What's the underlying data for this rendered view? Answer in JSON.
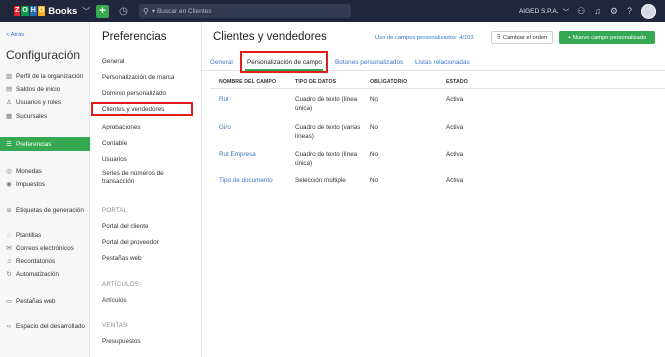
{
  "topbar": {
    "brand_letters": [
      "Z",
      "O",
      "H",
      "O"
    ],
    "brand_name": "Books",
    "search_placeholder": "Buscar en Clientes",
    "org_name": "AIGED S.P.A.",
    "colors": {
      "topbar_bg": "#21263c",
      "accent": "#36a852"
    }
  },
  "sidebar": {
    "back_label": "< Atrás",
    "title": "Configuración",
    "items": [
      {
        "label": "Perfil de la organización",
        "icon": "building-icon"
      },
      {
        "label": "Saldos de inicio",
        "icon": "balance-icon"
      },
      {
        "label": "Usuarios y roles",
        "icon": "users-icon"
      },
      {
        "label": "Sucursales",
        "icon": "branch-icon"
      },
      {
        "label": "Preferencias",
        "icon": "sliders-icon",
        "active": true
      },
      {
        "label": "Monedas",
        "icon": "currency-icon"
      },
      {
        "label": "Impuestos",
        "icon": "tax-icon"
      },
      {
        "label": "Etiquetas de generación",
        "icon": "tag-icon"
      },
      {
        "label": "Plantillas",
        "icon": "template-icon"
      },
      {
        "label": "Correos electrónicos",
        "icon": "mail-icon"
      },
      {
        "label": "Recordatorios",
        "icon": "bell-icon"
      },
      {
        "label": "Automatización",
        "icon": "automation-icon"
      },
      {
        "label": "Pestañas web",
        "icon": "web-tab-icon"
      },
      {
        "label": "Espacio del desarrollado",
        "icon": "code-icon"
      }
    ]
  },
  "preferences": {
    "title": "Preferencias",
    "items": [
      "General",
      "Personalización de marca",
      "Dominio personalizado",
      "Clientes y vendedores",
      "Aprobaciones",
      "Contable",
      "Usuarios",
      "Series de números de transacción"
    ],
    "sections": {
      "portal": {
        "label": "PORTAL",
        "items": [
          "Portal del cliente",
          "Portal del proveedor",
          "Pestañas web"
        ]
      },
      "articulos": {
        "label": "ARTÍCULOS",
        "items": [
          "Artículos"
        ]
      },
      "ventas": {
        "label": "VENTAS",
        "items": [
          "Presupuestos"
        ]
      }
    }
  },
  "main": {
    "title": "Clientes y vendedores",
    "usage_text": "Uso de campos personalizados: 4/103",
    "order_button": "Cambiar el orden",
    "new_field_button": "+ Nuevo campo personalizado",
    "tabs": [
      "General",
      "Personalización de campo",
      "Botones personalizados",
      "Listas relacionadas"
    ],
    "table": {
      "headers": [
        "NOMBRE DEL CAMPO",
        "TIPO DE DATOS",
        "OBLIGATORIO",
        "ESTADO"
      ],
      "rows": [
        {
          "name": "Rut",
          "type": "Cuadro de texto (línea única)",
          "required": "No",
          "status": "Activa"
        },
        {
          "name": "Giro",
          "type": "Cuadro de texto (varias líneas)",
          "required": "No",
          "status": "Activa"
        },
        {
          "name": "Rut Empresa",
          "type": "Cuadro de texto (línea única)",
          "required": "No",
          "status": "Activa"
        },
        {
          "name": "Tipo de documento",
          "type": "Selección múltiple",
          "required": "No",
          "status": "Activa"
        }
      ]
    }
  }
}
